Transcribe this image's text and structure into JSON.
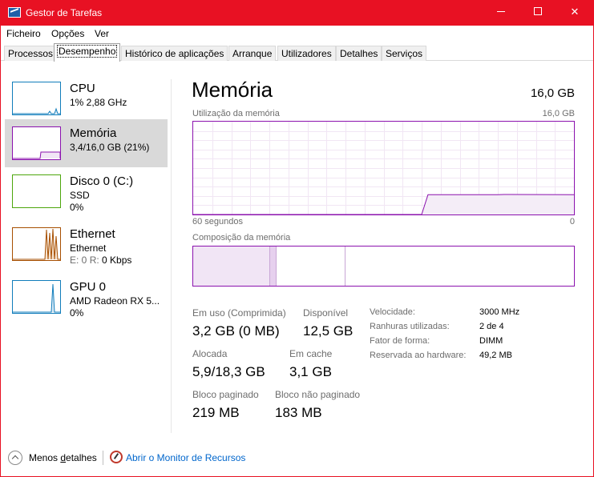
{
  "window": {
    "title": "Gestor de Tarefas",
    "accent": "#e81123"
  },
  "menu": [
    "Ficheiro",
    "Opções",
    "Ver"
  ],
  "tabs": [
    "Processos",
    "Desempenho",
    "Histórico de aplicações",
    "Arranque",
    "Utilizadores",
    "Detalhes",
    "Serviços"
  ],
  "active_tab": "Desempenho",
  "sidebar": {
    "items": [
      {
        "name": "CPU",
        "line1": "1%  2,88 GHz",
        "line2": "",
        "color": "#117dbb"
      },
      {
        "name": "Memória",
        "line1": "3,4/16,0 GB (21%)",
        "line2": "",
        "color": "#8b12ae"
      },
      {
        "name": "Disco 0 (C:)",
        "line1": "SSD",
        "line2": "0%",
        "color": "#4da60c"
      },
      {
        "name": "Ethernet",
        "line1": "Ethernet",
        "line2_e": "E: 0",
        "line2_r": "R: 0 Kbps",
        "color": "#a74f01"
      },
      {
        "name": "GPU 0",
        "line1": "AMD Radeon RX 5...",
        "line2": "0%",
        "color": "#117dbb"
      }
    ]
  },
  "main": {
    "title": "Memória",
    "total": "16,0 GB",
    "usage_label": "Utilização da memória",
    "usage_max": "16,0 GB",
    "time_left": "60 segundos",
    "time_right": "0",
    "composition_label": "Composição da memória",
    "stats": {
      "in_use_label": "Em uso (Comprimida)",
      "in_use_value": "3,2 GB (0 MB)",
      "available_label": "Disponível",
      "available_value": "12,5 GB",
      "committed_label": "Alocada",
      "committed_value": "5,9/18,3 GB",
      "cached_label": "Em cache",
      "cached_value": "3,1 GB",
      "paged_label": "Bloco paginado",
      "paged_value": "219 MB",
      "nonpaged_label": "Bloco não paginado",
      "nonpaged_value": "183 MB"
    },
    "details": [
      {
        "k": "Velocidade:",
        "v": "3000 MHz"
      },
      {
        "k": "Ranhuras utilizadas:",
        "v": "2 de 4"
      },
      {
        "k": "Fator de forma:",
        "v": "DIMM"
      },
      {
        "k": "Reservada ao hardware:",
        "v": "49,2 MB"
      }
    ]
  },
  "footer": {
    "fewer_prefix": "Menos ",
    "fewer_underlined": "d",
    "fewer_suffix": "etalhes",
    "resmon_link": "Abrir o Monitor de Recursos"
  },
  "chart_data": {
    "type": "area",
    "title": "Utilização da memória",
    "xlabel": "",
    "ylabel": "",
    "x_range": [
      60,
      0
    ],
    "ylim": [
      0,
      16.0
    ],
    "series": [
      {
        "x": [
          60,
          24,
          23,
          12,
          11,
          0
        ],
        "values": [
          0,
          0,
          3.4,
          3.4,
          3.45,
          3.4
        ]
      }
    ]
  }
}
